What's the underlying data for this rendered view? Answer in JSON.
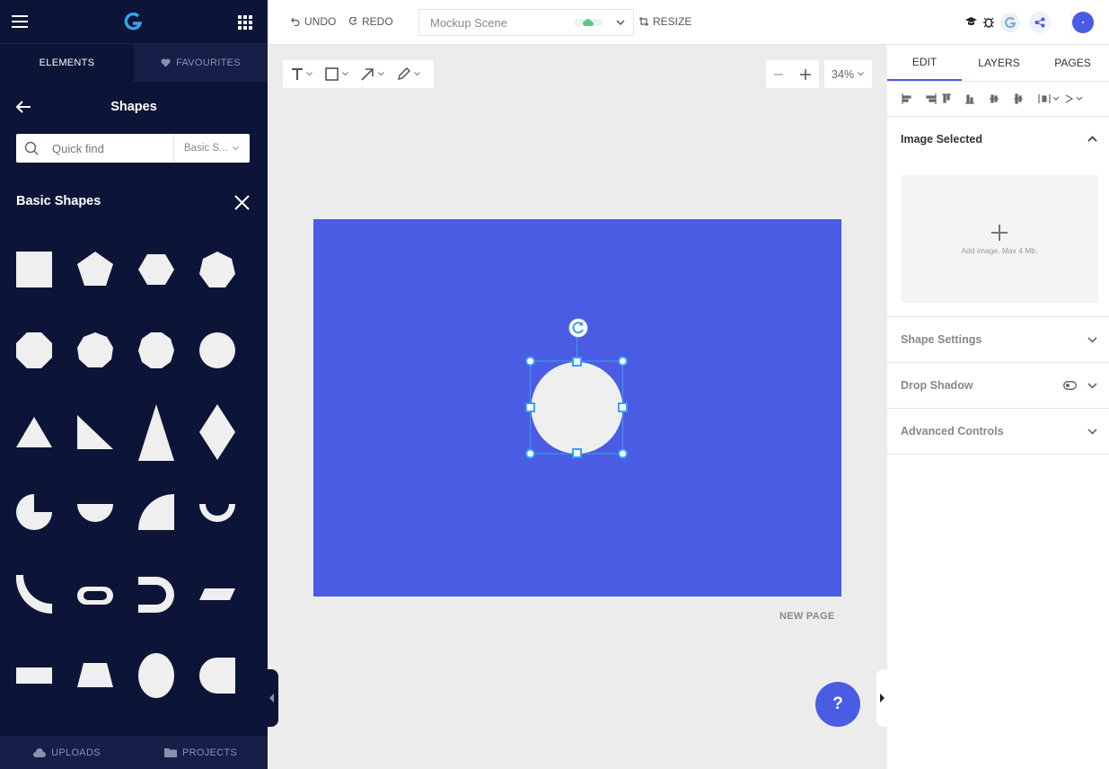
{
  "sidebar": {
    "tabs": {
      "elements": "ELEMENTS",
      "favourites": "FAVOURITES"
    },
    "title": "Shapes",
    "search": {
      "placeholder": "Quick find",
      "filter": "Basic S..."
    },
    "section_title": "Basic Shapes",
    "shapes": [
      "square",
      "pentagon",
      "hexagon",
      "heptagon",
      "octagon",
      "nonagon",
      "decagon",
      "circle",
      "triangle",
      "right-triangle",
      "tall-triangle",
      "diamond",
      "pie-three-quarter",
      "half-circle",
      "quarter-circle",
      "ring-half",
      "arc-quarter",
      "pill",
      "d-shape",
      "parallelogram",
      "rectangle",
      "trapezoid",
      "ellipse",
      "half-rounded-rect"
    ],
    "bottom": {
      "uploads": "UPLOADS",
      "projects": "PROJECTS"
    }
  },
  "topbar": {
    "undo": "UNDO",
    "redo": "REDO",
    "scene_name": "Mockup Scene",
    "resize": "RESIZE"
  },
  "canvas": {
    "zoom": "34%",
    "new_page": "NEW PAGE",
    "page_color": "#4a5ce4",
    "help": "?"
  },
  "right_panel": {
    "tabs": {
      "edit": "EDIT",
      "layers": "LAYERS",
      "pages": "PAGES"
    },
    "image_selected": "Image Selected",
    "add_image": "Add image. Max 4 Mb.",
    "shape_settings": "Shape Settings",
    "drop_shadow": "Drop Shadow",
    "advanced_controls": "Advanced Controls"
  },
  "colors": {
    "accent": "#4a5ce4",
    "sidebar": "#0c1538",
    "handle": "#3aa0e8"
  }
}
